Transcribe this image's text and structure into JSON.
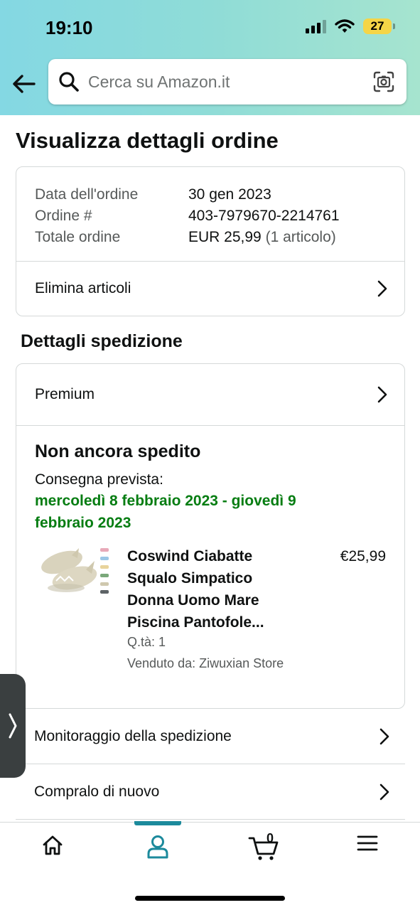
{
  "status_bar": {
    "time": "19:10",
    "battery": "27"
  },
  "search": {
    "placeholder": "Cerca su Amazon.it"
  },
  "page": {
    "title": "Visualizza dettagli ordine"
  },
  "order": {
    "rows": [
      {
        "label": "Data dell'ordine",
        "value": "30 gen 2023",
        "extra": ""
      },
      {
        "label": "Ordine #",
        "value": "403-7979670-2214761",
        "extra": ""
      },
      {
        "label": "Totale ordine",
        "value": "EUR 25,99",
        "extra": "(1 articolo)"
      }
    ],
    "delete_label": "Elimina articoli"
  },
  "shipping": {
    "title": "Dettagli spedizione",
    "service": "Premium",
    "status": "Non ancora spedito",
    "delivery_label": "Consegna prevista:",
    "delivery_date": "mercoledì 8 febbraio 2023 - giovedì 9 febbraio 2023",
    "product": {
      "title": "Coswind Ciabatte Squalo Simpatico Donna Uomo Mare Piscina Pantofole...",
      "price": "€25,99",
      "qty": "Q.tà: 1",
      "seller": "Venduto da: Ziwuxian Store"
    }
  },
  "actions": {
    "track": "Monitoraggio della spedizione",
    "buy_again": "Compralo di nuovo"
  },
  "bottom_nav": {
    "cart_count": "0",
    "active": "account"
  },
  "colors": {
    "accent": "#1c8a9c",
    "delivery_green": "#067d12",
    "header_gradient_start": "#84d8e3",
    "header_gradient_end": "#a6e4cf"
  }
}
